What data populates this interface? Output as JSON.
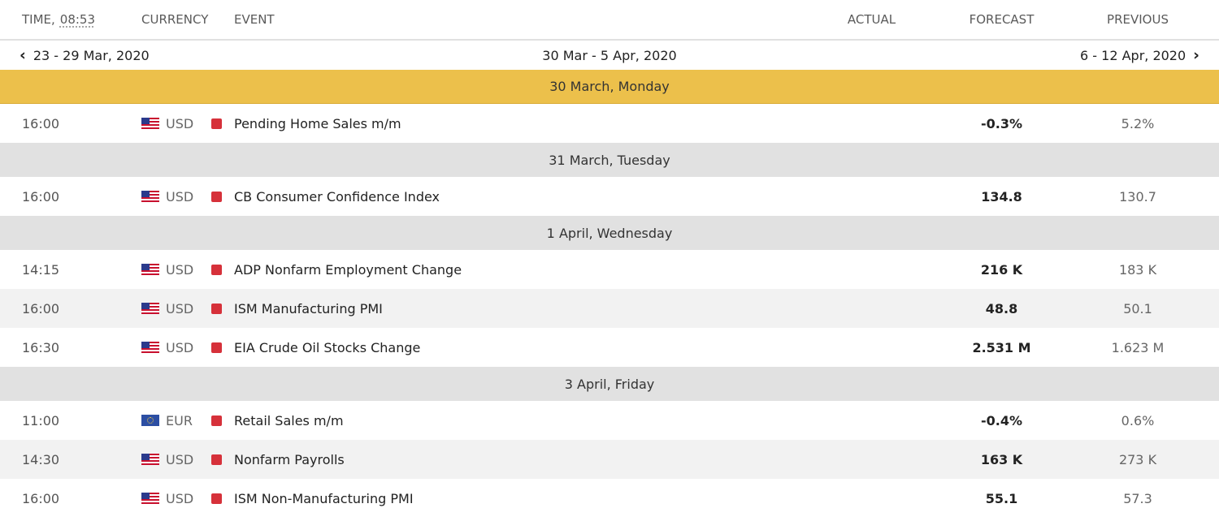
{
  "header": {
    "time_label": "TIME,",
    "time_value": "08:53",
    "currency": "CURRENCY",
    "event": "EVENT",
    "actual": "ACTUAL",
    "forecast": "FORECAST",
    "previous": "PREVIOUS"
  },
  "week_nav": {
    "prev": "23 - 29 Mar, 2020",
    "current": "30 Mar - 5 Apr, 2020",
    "next": "6 - 12 Apr, 2020"
  },
  "colors": {
    "active_day": "#ecc04b",
    "day_row": "#e1e1e1",
    "high_impact": "#d6313a"
  },
  "days": [
    {
      "label": "30 March, Monday",
      "events": [
        {
          "time": "16:00",
          "currency": "USD",
          "flag": "us-flag-icon",
          "event": "Pending Home Sales m/m",
          "actual": "",
          "forecast": "-0.3%",
          "previous": "5.2%"
        }
      ]
    },
    {
      "label": "31 March, Tuesday",
      "events": [
        {
          "time": "16:00",
          "currency": "USD",
          "flag": "us-flag-icon",
          "event": "CB Consumer Confidence Index",
          "actual": "",
          "forecast": "134.8",
          "previous": "130.7"
        }
      ]
    },
    {
      "label": "1 April, Wednesday",
      "events": [
        {
          "time": "14:15",
          "currency": "USD",
          "flag": "us-flag-icon",
          "event": "ADP Nonfarm Employment Change",
          "actual": "",
          "forecast": "216 K",
          "previous": "183 K"
        },
        {
          "time": "16:00",
          "currency": "USD",
          "flag": "us-flag-icon",
          "event": "ISM Manufacturing PMI",
          "actual": "",
          "forecast": "48.8",
          "previous": "50.1"
        },
        {
          "time": "16:30",
          "currency": "USD",
          "flag": "us-flag-icon",
          "event": "EIA Crude Oil Stocks Change",
          "actual": "",
          "forecast": "2.531 M",
          "previous": "1.623 M"
        }
      ]
    },
    {
      "label": "3 April, Friday",
      "events": [
        {
          "time": "11:00",
          "currency": "EUR",
          "flag": "eu-flag-icon",
          "event": "Retail Sales m/m",
          "actual": "",
          "forecast": "-0.4%",
          "previous": "0.6%"
        },
        {
          "time": "14:30",
          "currency": "USD",
          "flag": "us-flag-icon",
          "event": "Nonfarm Payrolls",
          "actual": "",
          "forecast": "163 K",
          "previous": "273 K"
        },
        {
          "time": "16:00",
          "currency": "USD",
          "flag": "us-flag-icon",
          "event": "ISM Non-Manufacturing PMI",
          "actual": "",
          "forecast": "55.1",
          "previous": "57.3"
        }
      ]
    }
  ]
}
